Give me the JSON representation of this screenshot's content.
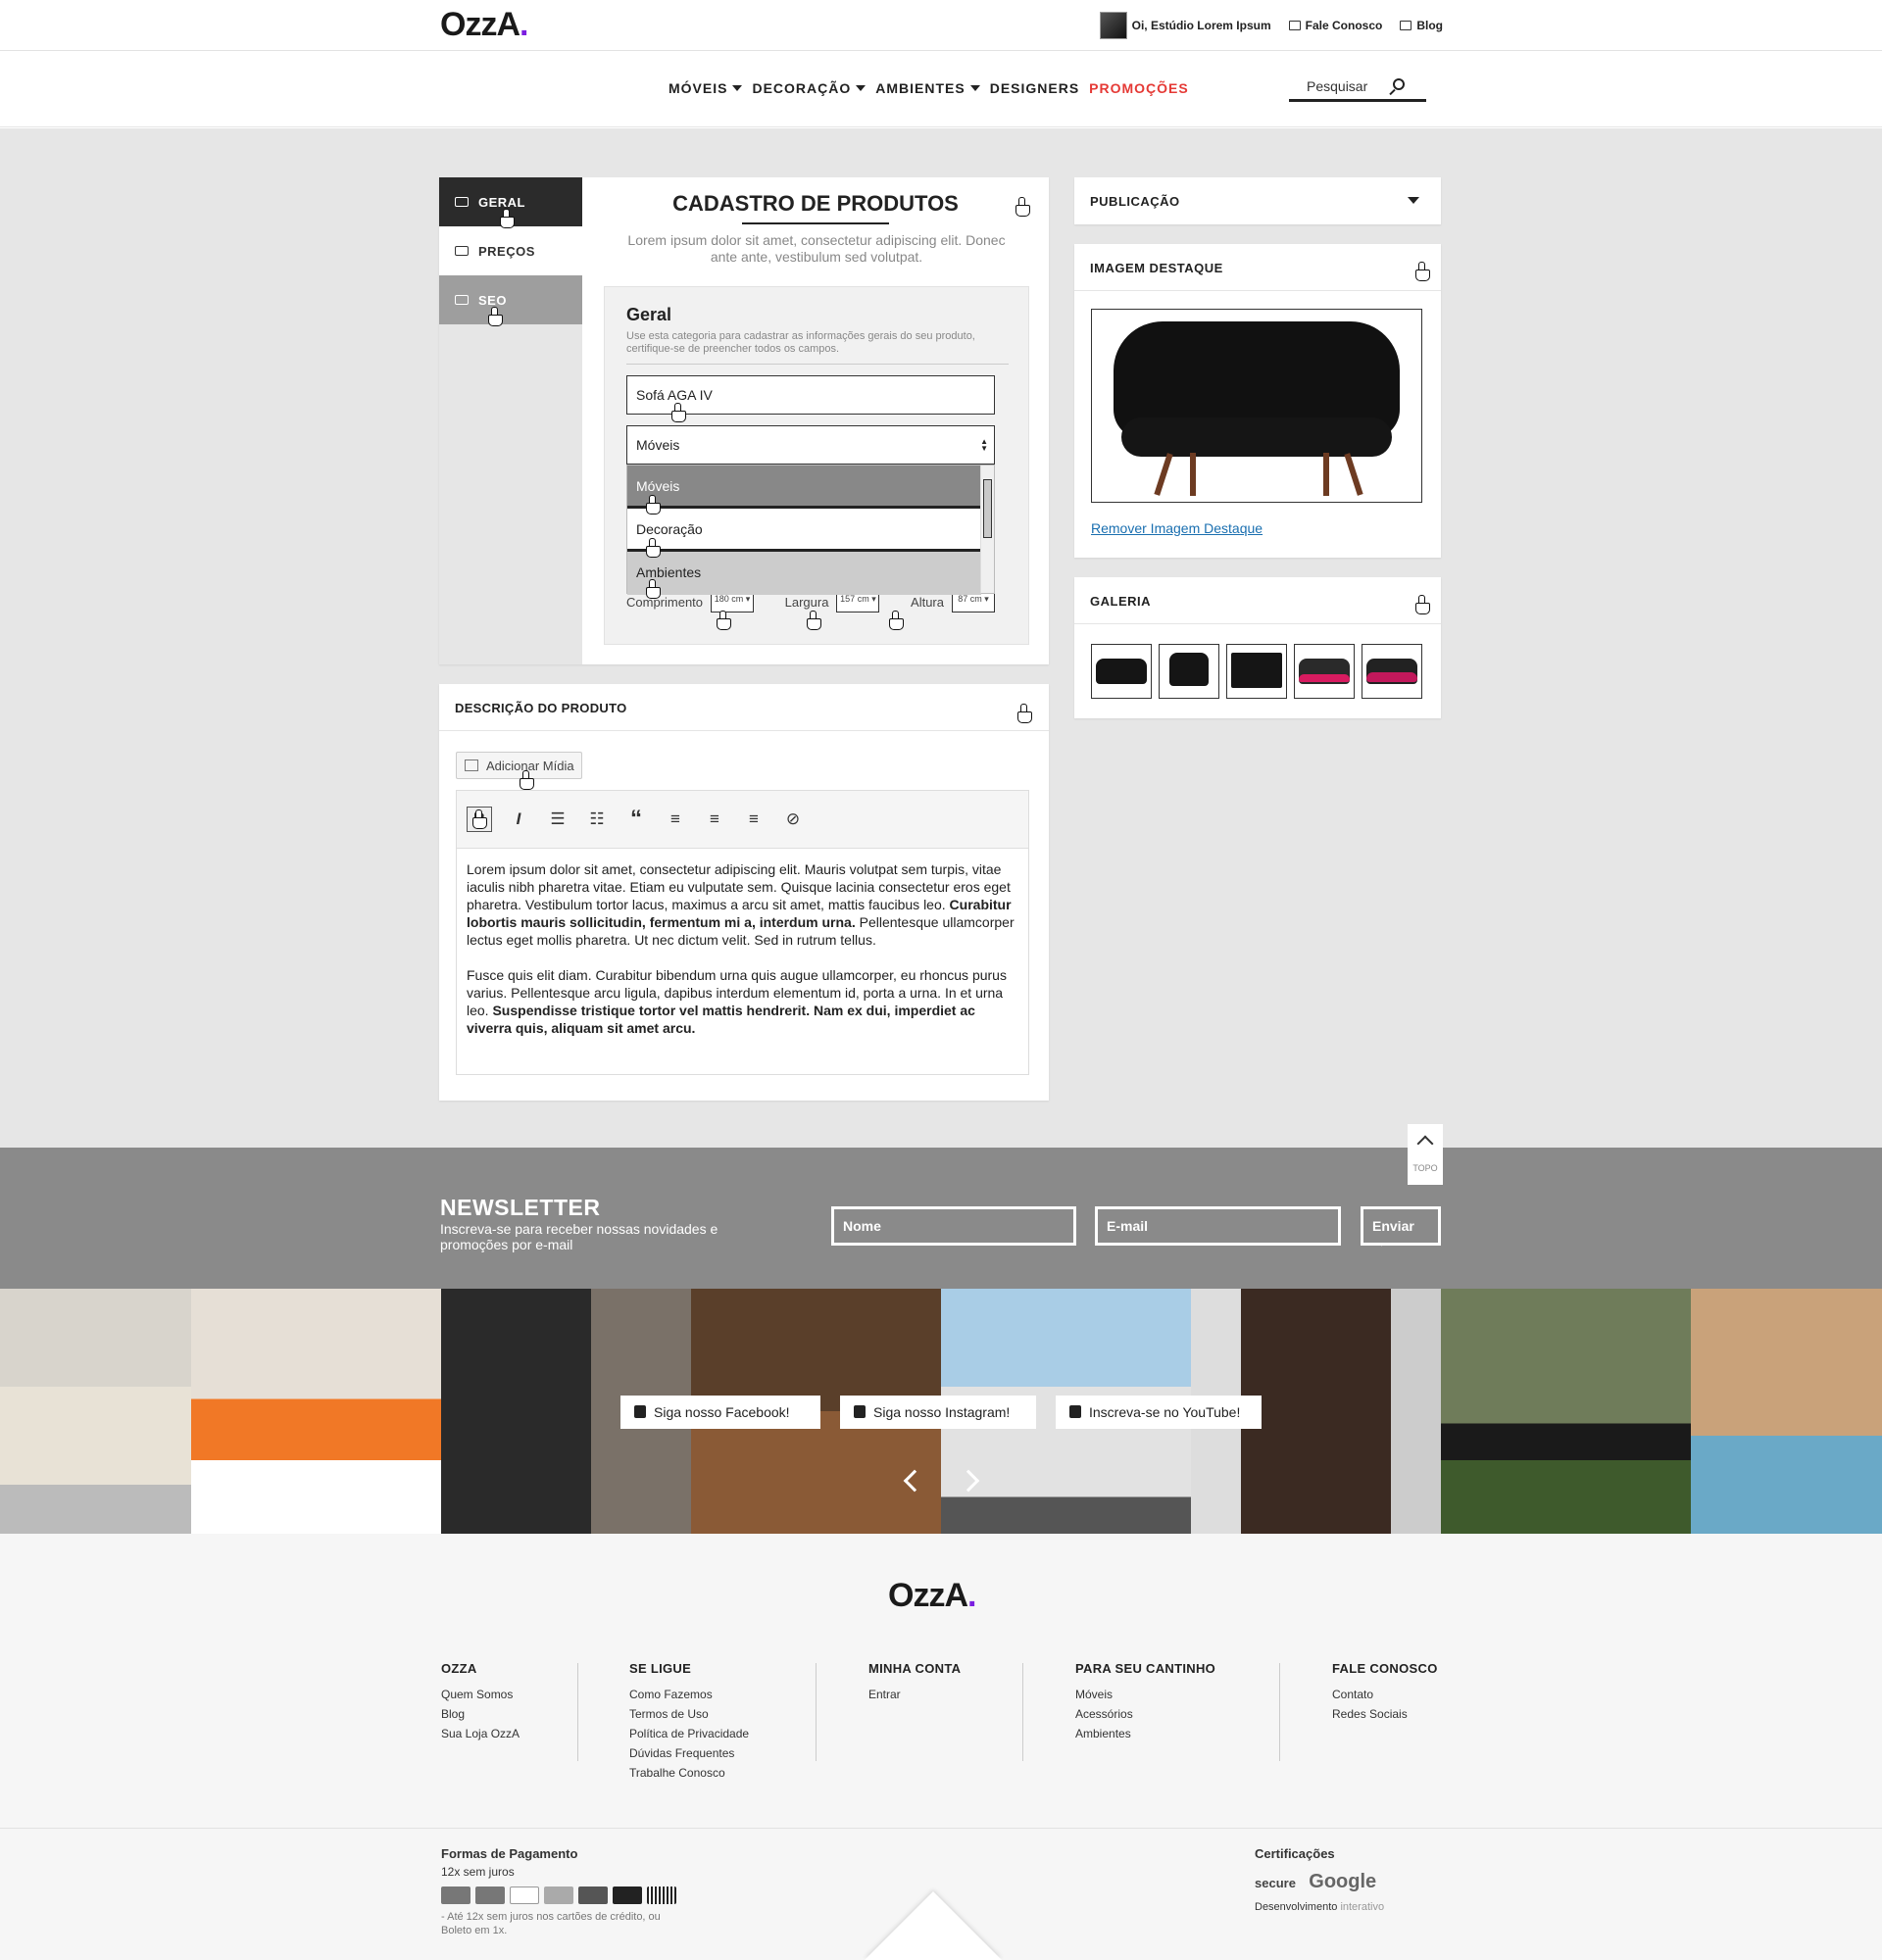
{
  "brand": {
    "logo": "OzzA",
    "logo_dot": ".",
    "accent": "#7b1fe0",
    "promo_color": "#e53935"
  },
  "topbar": {
    "greeting": "Oi, Estúdio Lorem Ipsum",
    "contact": "Fale Conosco",
    "blog": "Blog"
  },
  "nav": {
    "items": [
      {
        "label": "MÓVEIS",
        "has_caret": true
      },
      {
        "label": "DECORAÇÃO",
        "has_caret": true
      },
      {
        "label": "AMBIENTES",
        "has_caret": true
      },
      {
        "label": "DESIGNERS",
        "has_caret": false
      }
    ],
    "promo": "PROMOÇÕES",
    "search_placeholder": "Pesquisar"
  },
  "editor": {
    "tabs": [
      {
        "label": "GERAL",
        "icon": "list-icon"
      },
      {
        "label": "PREÇOS",
        "icon": "money-icon"
      },
      {
        "label": "SEO",
        "icon": "link-icon"
      }
    ],
    "title": "CADASTRO DE PRODUTOS",
    "subtitle": "Lorem ipsum dolor sit amet, consectetur adipiscing elit. Donec ante ante, vestibulum sed volutpat.",
    "section_title": "Geral",
    "section_desc": "Use esta categoria para cadastrar as informações gerais do seu produto, certifique-se de preencher todos os campos.",
    "name_value": "Sofá AGA IV",
    "category_value": "Móveis",
    "category_options": [
      "Móveis",
      "Decoração",
      "Ambientes"
    ],
    "dims": {
      "comprimento": {
        "label": "Comprimento",
        "value": "180",
        "unit": "cm"
      },
      "largura": {
        "label": "Largura",
        "value": "157",
        "unit": "cm"
      },
      "altura": {
        "label": "Altura",
        "value": "87",
        "unit": "cm"
      }
    }
  },
  "sidebar": {
    "publicacao": "PUBLICAÇÃO",
    "imagem_destaque": "IMAGEM DESTAQUE",
    "remove_image": "Remover Imagem Destaque",
    "galeria": "GALERIA"
  },
  "description": {
    "title": "DESCRIÇÃO DO PRODUTO",
    "add_media": "Adicionar Mídia",
    "p1_a": "Lorem ipsum dolor sit amet, consectetur adipiscing elit. Mauris volutpat sem turpis, vitae iaculis nibh pharetra vitae. Etiam eu vulputate sem. Quisque lacinia consectetur eros eget pharetra. Vestibulum tortor lacus, maximus a arcu sit amet, mattis faucibus leo. ",
    "p1_b": "Curabitur lobortis mauris sollicitudin, fermentum mi a, interdum urna.",
    "p1_c": " Pellentesque ullamcorper lectus eget mollis pharetra. Ut nec dictum velit. Sed in rutrum tellus.",
    "p2_a": "Fusce quis elit diam. Curabitur bibendum urna quis augue ullamcorper, eu rhoncus purus varius. Pellentesque arcu ligula, dapibus interdum elementum id, porta a urna. In et urna leo. ",
    "p2_b": "Suspendisse tristique tortor vel mattis hendrerit. Nam ex dui, imperdiet ac viverra quis, aliquam sit amet arcu."
  },
  "newsletter": {
    "title": "NEWSLETTER",
    "subtitle": "Inscreva-se para receber nossas novidades e promoções por e-mail",
    "name_placeholder": "Nome",
    "email_placeholder": "E-mail",
    "submit": "Enviar →",
    "top": "TOPO"
  },
  "social": {
    "facebook": "Siga nosso Facebook!",
    "instagram": "Siga nosso Instagram!",
    "youtube": "Inscreva-se no YouTube!"
  },
  "footer": {
    "columns": [
      {
        "title": "OZZA",
        "links": [
          "Quem Somos",
          "Blog",
          "Sua Loja OzzA"
        ]
      },
      {
        "title": "SE LIGUE",
        "links": [
          "Como Fazemos",
          "Termos de Uso",
          "Política de Privacidade",
          "Dúvidas Frequentes",
          "Trabalhe Conosco"
        ]
      },
      {
        "title": "MINHA CONTA",
        "links": [
          "Entrar"
        ]
      },
      {
        "title": "PARA SEU CANTINHO",
        "links": [
          "Móveis",
          "Acessórios",
          "Ambientes"
        ]
      },
      {
        "title": "FALE CONOSCO",
        "links": [
          "Contato",
          "Redes Sociais"
        ]
      }
    ],
    "payment_title": "Formas de Pagamento",
    "payment_sub": "12x sem juros",
    "payment_note": "- Até 12x sem juros nos cartões de crédito, ou Boleto em 1x.",
    "cert_title": "Certificações",
    "cert_secure": "secure",
    "cert_google": "Google",
    "dev_label": "Desenvolvimento",
    "dev_name": "interativo"
  }
}
